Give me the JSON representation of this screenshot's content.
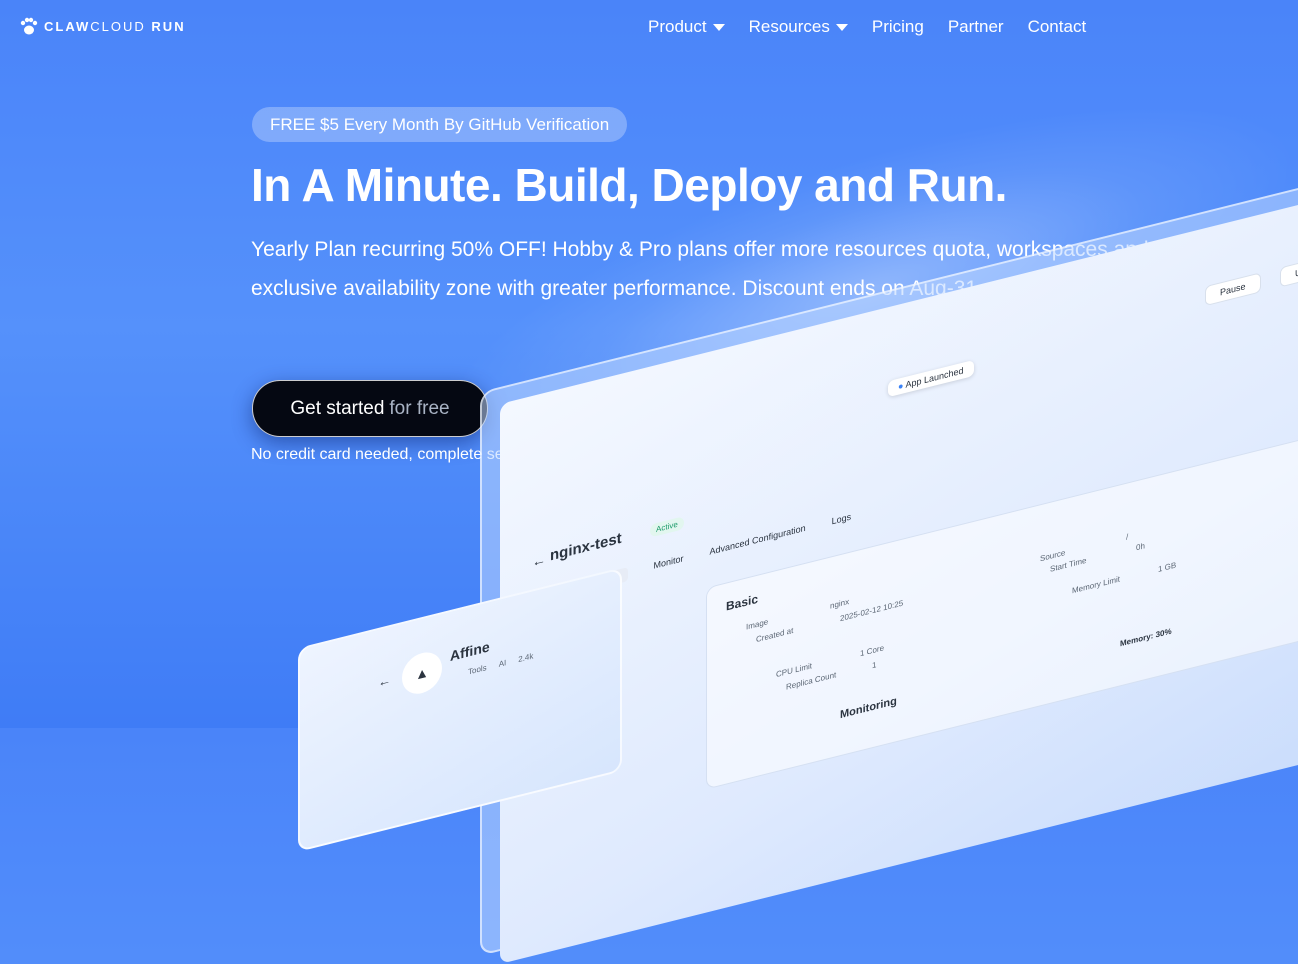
{
  "brand": {
    "name_light": "CLAW",
    "name_mid": "CLOUD",
    "name_bold": "RUN"
  },
  "nav": [
    {
      "label": "Product",
      "dropdown": true
    },
    {
      "label": "Resources",
      "dropdown": true
    },
    {
      "label": "Pricing",
      "dropdown": false
    },
    {
      "label": "Partner",
      "dropdown": false
    },
    {
      "label": "Contact",
      "dropdown": false
    }
  ],
  "hero": {
    "pill": "FREE $5 Every Month By GitHub Verification",
    "headline": "In A Minute. Build, Deploy and Run.",
    "description": "Yearly Plan recurring 50% OFF! Hobby & Pro plans offer more resources quota, workspaces and exclusive availability zone with greater performance. Discount ends on Aug-31.",
    "cta_primary": "Get started",
    "cta_secondary": "for free",
    "note": "No credit card needed, complete setup in 1 min."
  },
  "mockup": {
    "toast": "App Launched",
    "app_name": "nginx-test",
    "status": "Active",
    "tabs": [
      "Overview",
      "Monitor",
      "Advanced Configuration",
      "Logs"
    ],
    "buttons": [
      "Pause",
      "Update"
    ],
    "section": "Basic",
    "fields": {
      "image_label": "Image",
      "image_value": "nginx",
      "created_label": "Created at",
      "created_value": "2025-02-12 10:25",
      "cpu_label": "CPU Limit",
      "cpu_value": "1 Core",
      "replica_label": "Replica Count",
      "replica_value": "1",
      "source_label": "Source",
      "source_value": "/",
      "start_label": "Start Time",
      "start_value": "0h",
      "memory_label": "Memory Limit",
      "memory_value": "1 GB"
    },
    "memory_usage": "Memory: 30%",
    "monitoring": "Monitoring"
  },
  "mockup2": {
    "app_name": "Affine",
    "tags": [
      "Tools",
      "AI",
      "2.4k"
    ]
  },
  "colors": {
    "background": "#4a84f9",
    "cta_bg": "#050812"
  }
}
